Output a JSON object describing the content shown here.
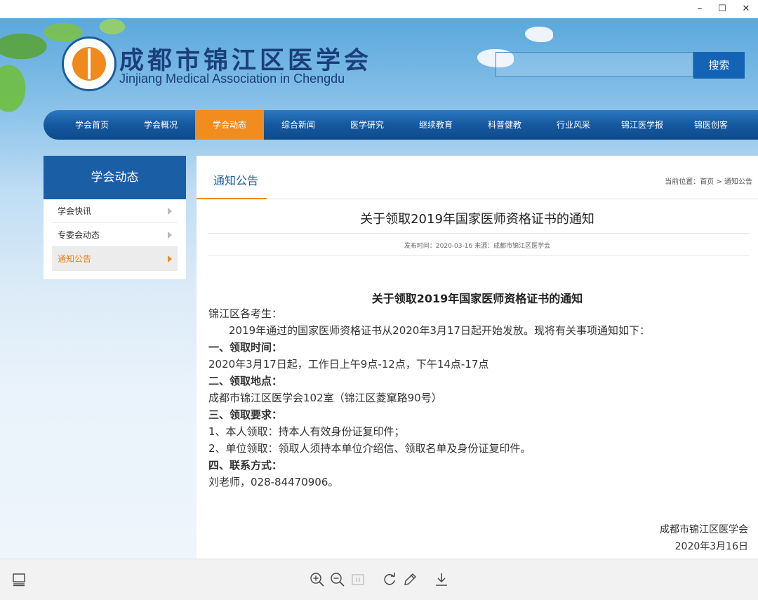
{
  "site": {
    "name_cn": "成都市锦江区医学会",
    "name_en": "Jinjiang Medical Association in Chengdu",
    "search_button": "搜索"
  },
  "nav": [
    "学会首页",
    "学会概况",
    "学会动态",
    "综合新闻",
    "医学研究",
    "继续教育",
    "科普健教",
    "行业风采",
    "锦江医学报",
    "锦医创客"
  ],
  "nav_active": "学会动态",
  "sidebar": {
    "title": "学会动态",
    "items": [
      "学会快讯",
      "专委会动态",
      "通知公告"
    ],
    "active": "通知公告"
  },
  "content": {
    "section_title": "通知公告",
    "breadcrumb": "当前位置：首页 > 通知公告",
    "article_title": "关于领取2019年国家医师资格证书的通知",
    "meta": "发布时间：2020-03-16 来源：成都市锦江区医学会",
    "body_title": "关于领取2019年国家医师资格证书的通知",
    "greeting": "锦江区各考生：",
    "intro": "2019年通过的国家医师资格证书从2020年3月17日起开始发放。现将有关事项通知如下：",
    "sec1_head": "一、领取时间：",
    "sec1_text": "2020年3月17日起，工作日上午9点-12点，下午14点-17点",
    "sec2_head": "二、领取地点：",
    "sec2_text": "成都市锦江区医学会102室（锦江区菱窠路90号）",
    "sec3_head": "三、领取要求：",
    "sec3_item1": "1、本人领取：持本人有效身份证复印件；",
    "sec3_item2": "2、单位领取：领取人须持本单位介绍信、领取名单及身份证复印件。",
    "sec4_head": "四、联系方式：",
    "sec4_text": "刘老师，028-84470906。",
    "signature_org": "成都市锦江区医学会",
    "signature_date": "2020年3月16日"
  },
  "window": {
    "minimize": "–",
    "maximize": "☐",
    "close": "✕"
  },
  "colors": {
    "nav_blue": "#16589e",
    "accent_orange": "#f28c1e",
    "sidebar_head": "#1a5ea6",
    "search_button": "#1463b4"
  },
  "icons": {
    "toolbar": [
      "panel-toggle-icon",
      "zoom-in-icon",
      "zoom-out-icon",
      "actual-size-icon",
      "rotate-icon",
      "edit-icon",
      "download-icon"
    ]
  }
}
